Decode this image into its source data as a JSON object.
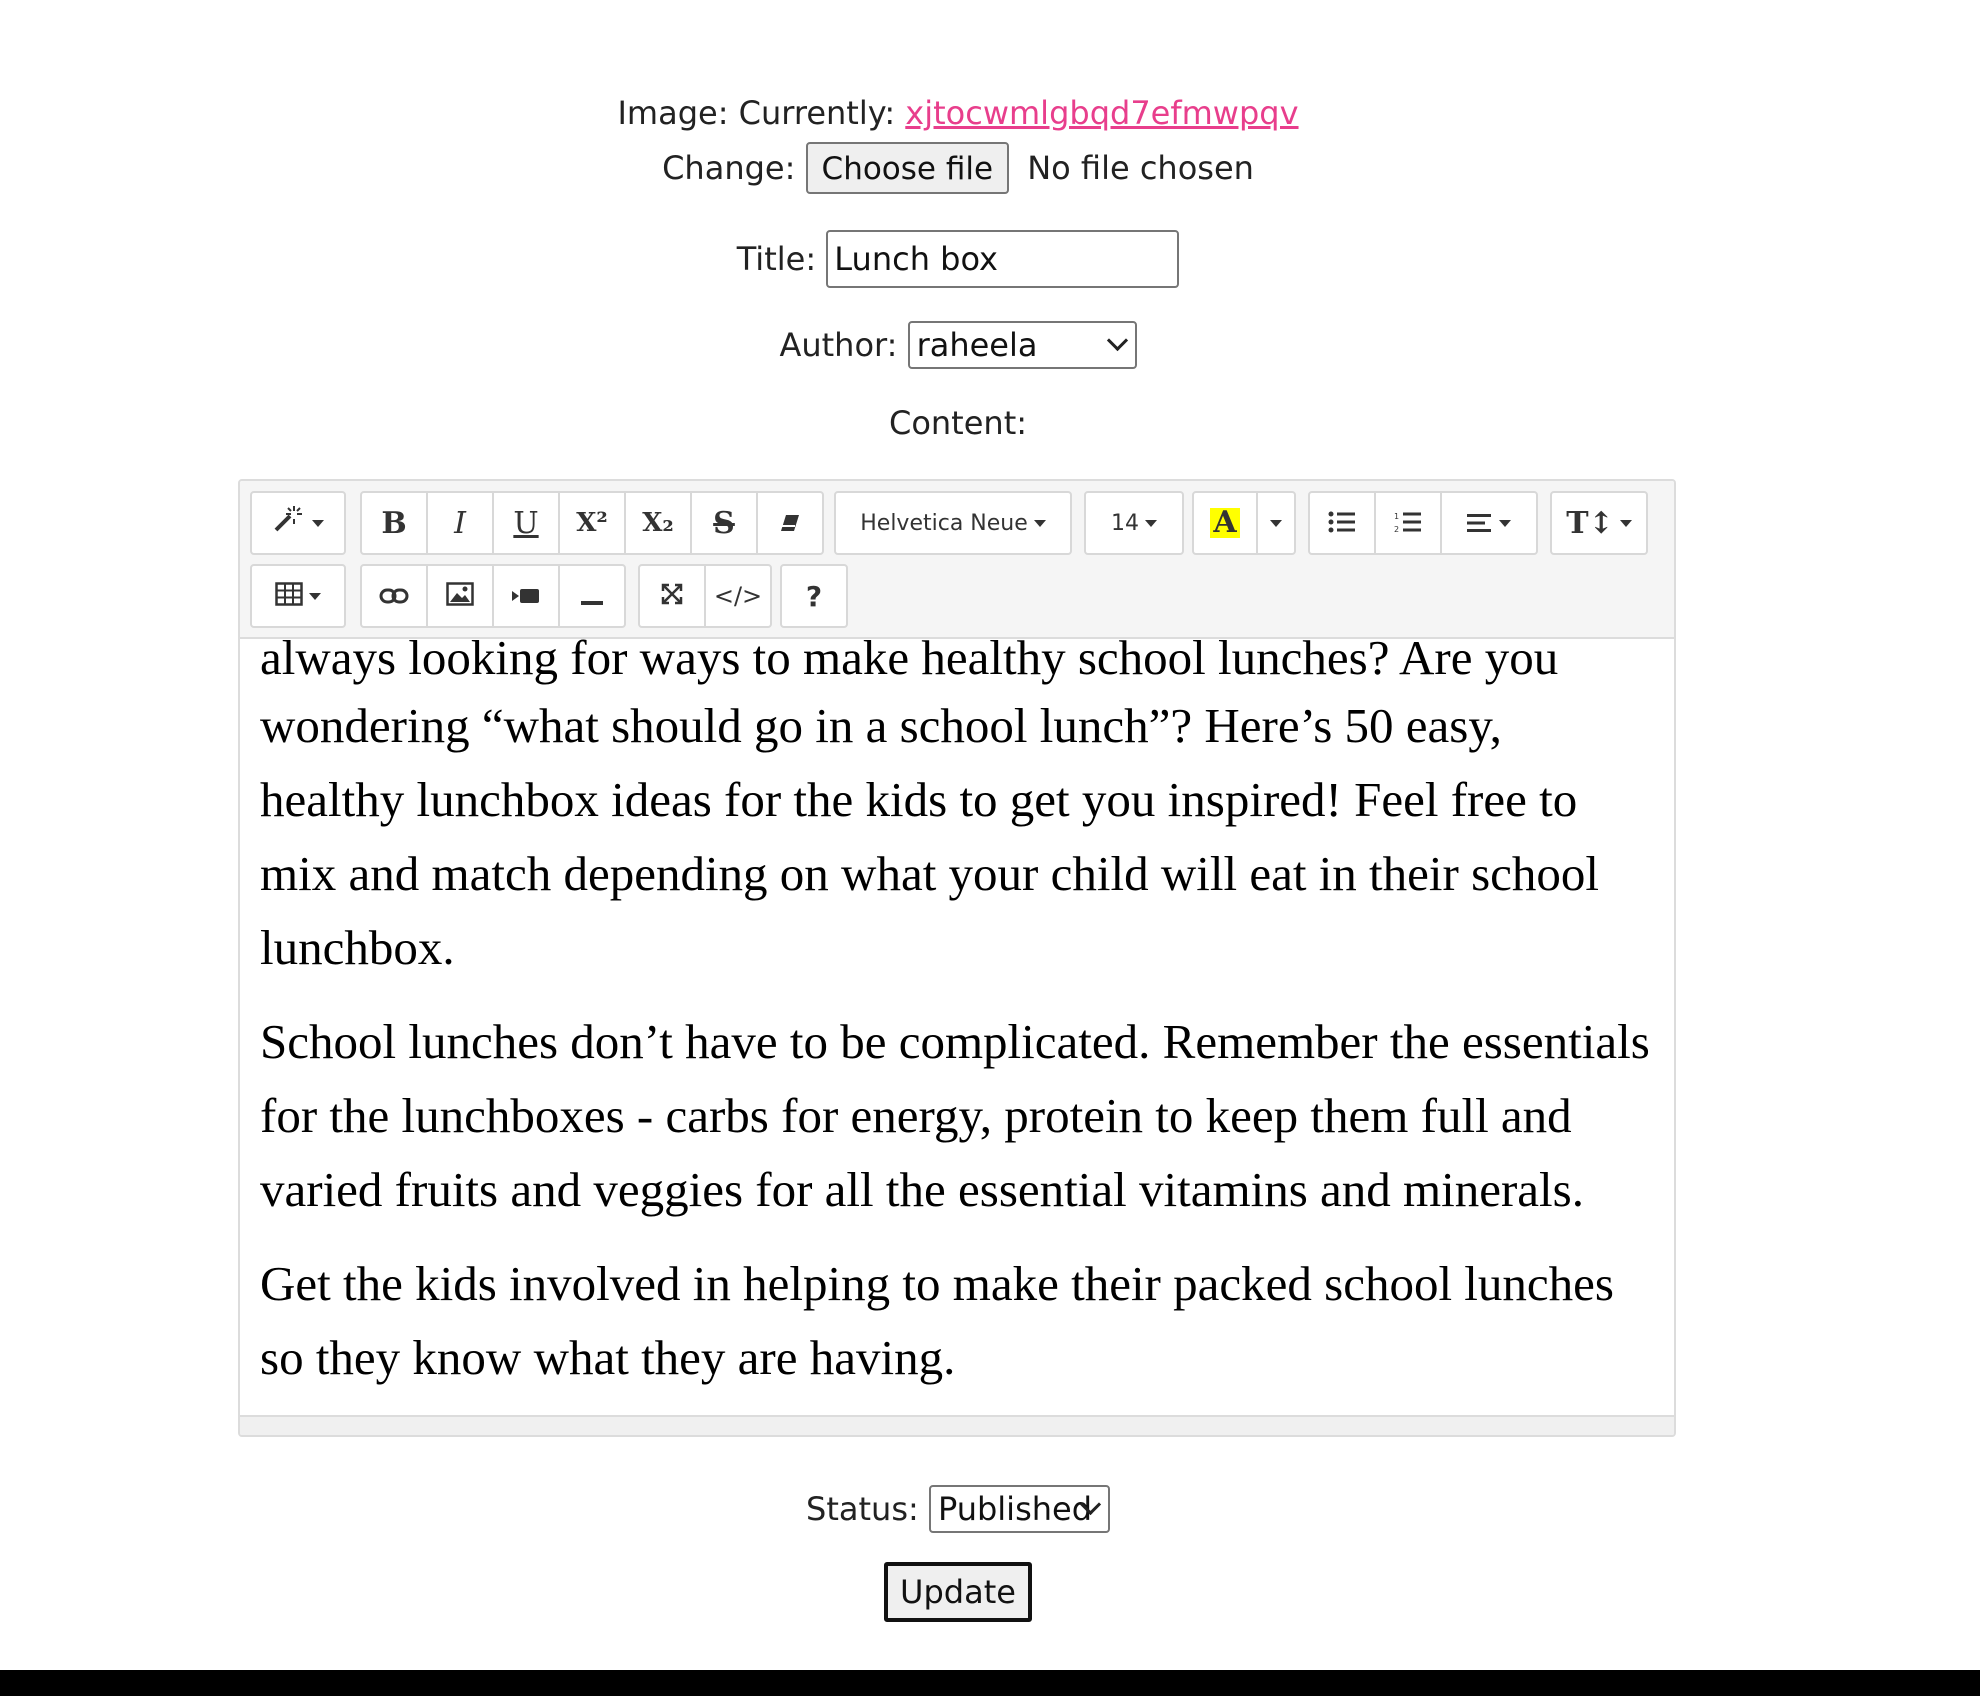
{
  "form": {
    "image_label": "Image: Currently:",
    "image_link": "xjtocwmlgbqd7efmwpqv",
    "change_label": "Change:",
    "choose_file": "Choose file",
    "no_file": "No file chosen",
    "title_label": "Title:",
    "title_value": "Lunch box",
    "author_label": "Author:",
    "author_value": "raheela",
    "content_label": "Content:",
    "status_label": "Status:",
    "status_value": "Published",
    "update_button": "Update"
  },
  "toolbar": {
    "font_name": "Helvetica Neue",
    "font_size": "14",
    "help": "?",
    "code": "</>",
    "color_letter": "A",
    "bold": "B",
    "italic": "I",
    "underline": "U",
    "superscript": "X²",
    "subscript": "X₂",
    "strikethrough": "S",
    "text_height": "T↕"
  },
  "content": {
    "cut_line_top": "always looking for ways to make healthy school lunches? Are you",
    "paragraph_1": "wondering “what should go in a school lunch”?  Here’s 50 easy, healthy lunchbox ideas for the kids to get you inspired! Feel free to mix and match depending on what your child will eat in their school lunchbox.",
    "paragraph_2": "School lunches don’t have to be complicated. Remember the essentials for the lunchboxes - carbs for energy, protein to keep them full and varied fruits and veggies for all the essential vitamins and minerals.",
    "paragraph_3": "Get the kids involved in helping to make their packed school lunches so they know what they are having."
  },
  "colors": {
    "link": "#e83e8c",
    "toolbar_bg": "#f5f5f5",
    "highlight": "#ffff00"
  }
}
